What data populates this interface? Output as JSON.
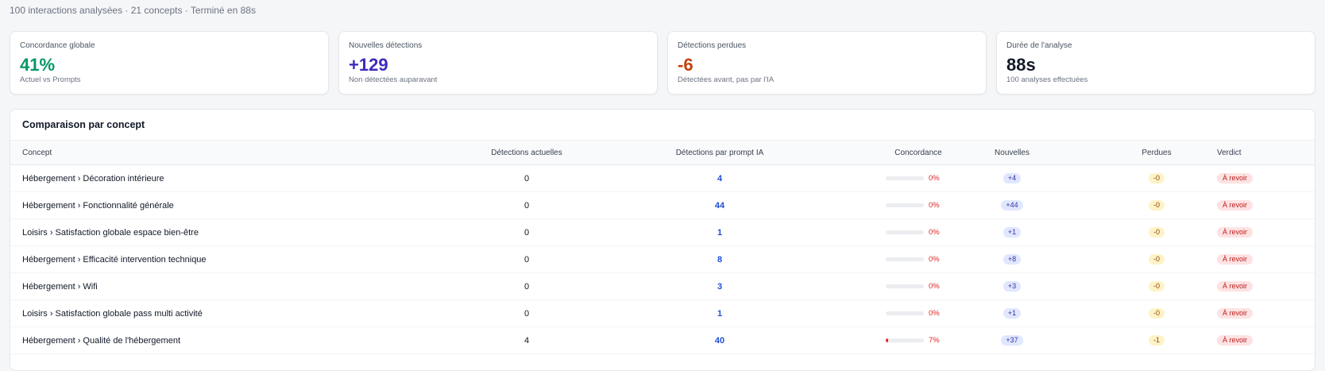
{
  "summary": "100 interactions analysées · 21 concepts · Terminé en 88s",
  "cards": [
    {
      "label": "Concordance globale",
      "value": "41%",
      "sub": "Actuel vs Prompts",
      "color": "#059669"
    },
    {
      "label": "Nouvelles détections",
      "value": "+129",
      "sub": "Non détectées auparavant",
      "color": "#3b2bbf"
    },
    {
      "label": "Détections perdues",
      "value": "-6",
      "sub": "Détectées avant, pas par l'IA",
      "color": "#c2410c"
    },
    {
      "label": "Durée de l'analyse",
      "value": "88s",
      "sub": "100 analyses effectuées",
      "color": "#111827"
    }
  ],
  "table": {
    "title": "Comparaison par concept",
    "headers": {
      "concept": "Concept",
      "actual": "Détections actuelles",
      "prompt": "Détections par prompt IA",
      "concordance": "Concordance",
      "new": "Nouvelles",
      "lost": "Perdues",
      "verdict": "Verdict"
    },
    "rows": [
      {
        "concept": "Hébergement › Décoration intérieure",
        "actual": "0",
        "prompt": "4",
        "concordance_pct": 0,
        "concordance": "0%",
        "new": "+4",
        "lost": "-0",
        "verdict": "À revoir"
      },
      {
        "concept": "Hébergement › Fonctionnalité générale",
        "actual": "0",
        "prompt": "44",
        "concordance_pct": 0,
        "concordance": "0%",
        "new": "+44",
        "lost": "-0",
        "verdict": "À revoir"
      },
      {
        "concept": "Loisirs › Satisfaction globale espace bien-être",
        "actual": "0",
        "prompt": "1",
        "concordance_pct": 0,
        "concordance": "0%",
        "new": "+1",
        "lost": "-0",
        "verdict": "À revoir"
      },
      {
        "concept": "Hébergement › Efficacité intervention technique",
        "actual": "0",
        "prompt": "8",
        "concordance_pct": 0,
        "concordance": "0%",
        "new": "+8",
        "lost": "-0",
        "verdict": "À revoir"
      },
      {
        "concept": "Hébergement › Wifi",
        "actual": "0",
        "prompt": "3",
        "concordance_pct": 0,
        "concordance": "0%",
        "new": "+3",
        "lost": "-0",
        "verdict": "À revoir"
      },
      {
        "concept": "Loisirs › Satisfaction globale pass multi activité",
        "actual": "0",
        "prompt": "1",
        "concordance_pct": 0,
        "concordance": "0%",
        "new": "+1",
        "lost": "-0",
        "verdict": "À revoir"
      },
      {
        "concept": "Hébergement › Qualité de l'hébergement",
        "actual": "4",
        "prompt": "40",
        "concordance_pct": 7,
        "concordance": "7%",
        "new": "+37",
        "lost": "-1",
        "verdict": "À revoir"
      }
    ]
  }
}
